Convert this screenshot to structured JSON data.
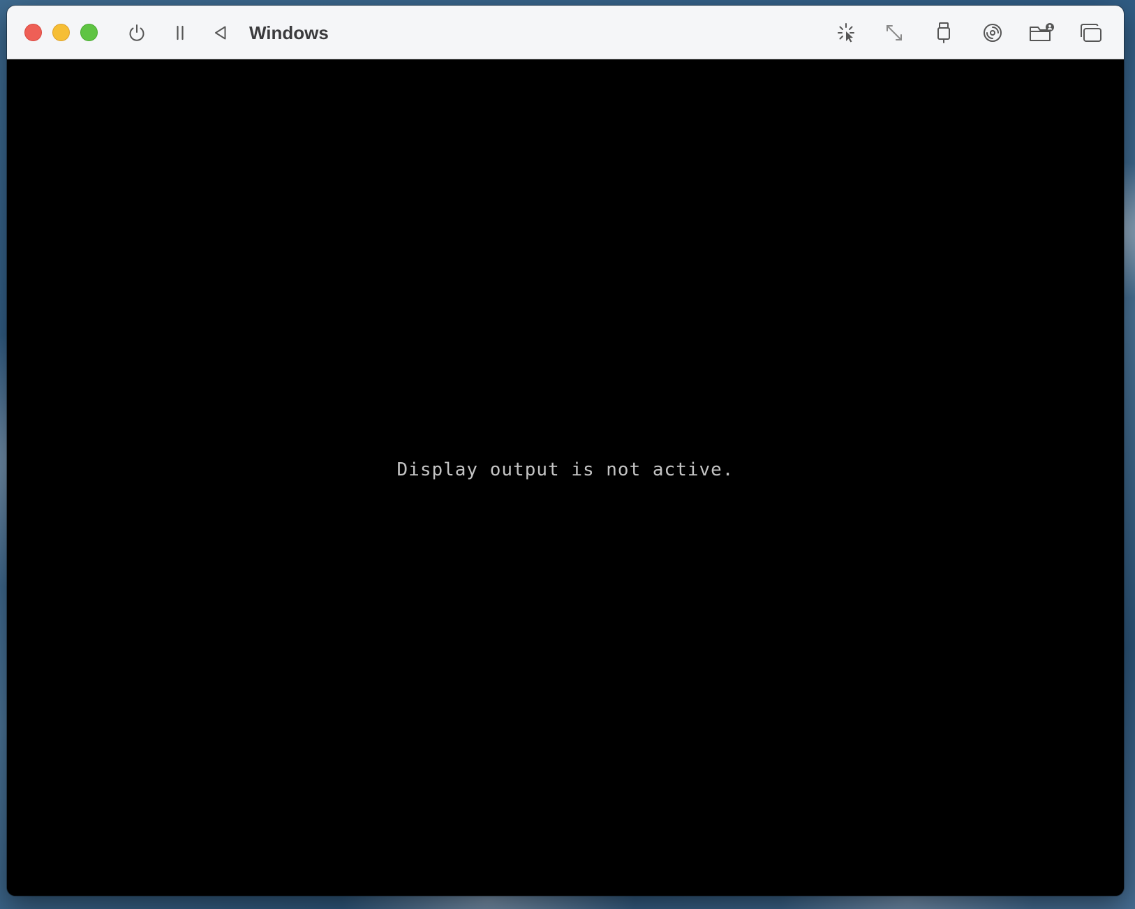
{
  "window": {
    "title": "Windows",
    "controls": {
      "close": {
        "label": "close",
        "color": "#ee5f56"
      },
      "minimize": {
        "label": "minimize",
        "color": "#f6be35"
      },
      "zoom": {
        "label": "zoom",
        "color": "#5fc443"
      }
    }
  },
  "toolbar": {
    "left_icons": [
      "power-icon",
      "pause-icon",
      "back-triangle-icon"
    ],
    "right_icons": [
      "capture-cursor-icon",
      "resize-arrows-icon",
      "usb-device-icon",
      "disc-icon",
      "shared-folder-icon",
      "windows-icon"
    ]
  },
  "screen": {
    "message": "Display output is not active.",
    "background": "#000000",
    "text_color": "#c4c4c4"
  }
}
